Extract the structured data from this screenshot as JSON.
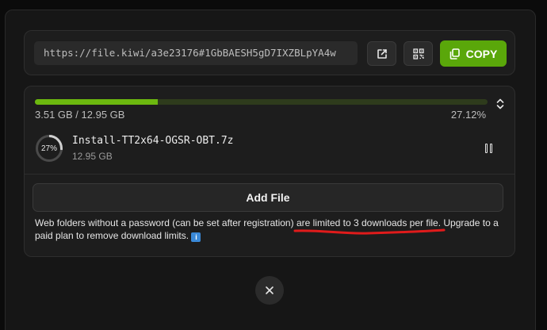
{
  "share": {
    "url": "https://file.kiwi/a3e23176#1GbBAESH5gD7IXZBLpYA4w",
    "copy_label": "COPY",
    "icons": {
      "open": "external-link-icon",
      "qr": "qr-code-icon",
      "copy": "copy-icon"
    }
  },
  "upload": {
    "size_text": "3.51 GB / 12.95 GB",
    "percent_text": "27.12%",
    "progress": 0.2712,
    "file": {
      "name": "Install-TT2x64-OGSR-OBT.7z",
      "size": "12.95 GB",
      "ring_percent_label": "27%",
      "ring_progress": 0.27
    },
    "add_file_label": "Add File",
    "notice": {
      "part1": "Web folders without a password (can be set after registration) ",
      "highlight": "are limited to 3 downloads per file",
      "part2": ". Upgrade to a paid plan to remove download limits.",
      "info_icon": "i"
    }
  },
  "colors": {
    "accent": "#5aa70a",
    "progress_fill": "#6cb80f",
    "progress_track": "#2e3b1c",
    "annotation": "#e01b1b",
    "info": "#3a89d8"
  }
}
